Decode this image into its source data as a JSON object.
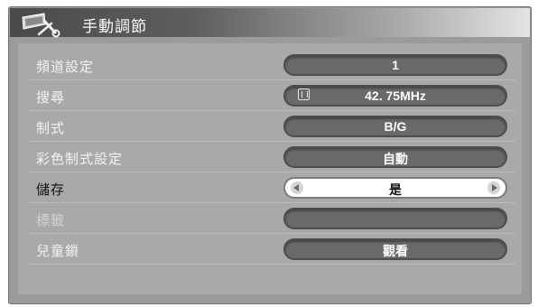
{
  "window": {
    "title": "手動調節"
  },
  "menu": [
    {
      "label": "頻道設定",
      "value": "1",
      "state": "normal"
    },
    {
      "label": "搜尋",
      "value": "42. 75MHz",
      "state": "normal",
      "icon": "search-mode-icon"
    },
    {
      "label": "制式",
      "value": "B/G",
      "state": "normal"
    },
    {
      "label": "彩色制式設定",
      "value": "自動",
      "state": "normal"
    },
    {
      "label": "儲存",
      "value": "是",
      "state": "selected"
    },
    {
      "label": "標籤",
      "value": "",
      "state": "dimmed"
    },
    {
      "label": "兒童鎖",
      "value": "觀看",
      "state": "normal"
    }
  ],
  "colors": {
    "panel": "#9b9b9b",
    "content": "#a9a9a9",
    "pill": "#696969",
    "highlight_pill": "#ffffff"
  }
}
